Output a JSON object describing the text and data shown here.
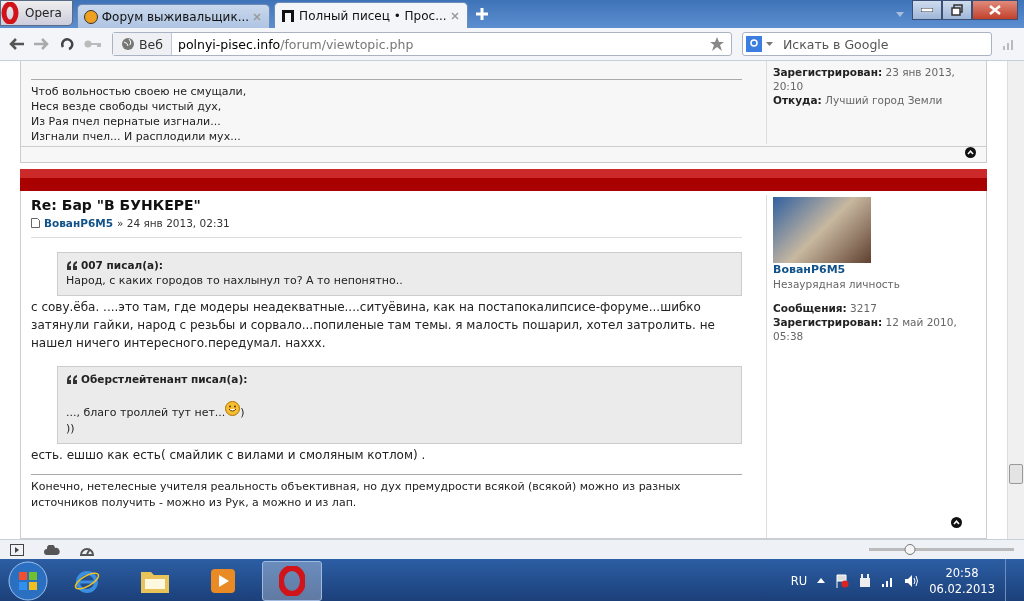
{
  "browser": {
    "menu_label": "Opera",
    "tabs": [
      {
        "title": "Форум выживальщик...",
        "kind": "forum",
        "selected": false
      },
      {
        "title": "Полный писец • Прос...",
        "kind": "letter",
        "selected": true
      }
    ],
    "toolbar": {
      "site_label": "Веб",
      "url_host": "polnyi-pisec.info",
      "url_path": "/forum/viewtopic.php",
      "search_placeholder": "Искать в Google"
    }
  },
  "previous_post": {
    "profile": [
      {
        "label": "Зарегистрирован:",
        "value": "23 янв 2013, 20:10"
      },
      {
        "label": "Откуда:",
        "value": "Лучший город Земли"
      }
    ],
    "signature": [
      "Чтоб вольностью своею не смущали,",
      "Неся везде свободы чистый дух,",
      "Из Рая пчел пернатые изгнали...",
      "Изгнали пчел... И расплодили мух..."
    ]
  },
  "post": {
    "title": "Re: Бар \"В БУНКЕРЕ\"",
    "author": "ВованР6М5",
    "date": "» 24 янв 2013, 02:31",
    "content": [
      {
        "kind": "quote",
        "author": "007 писал(а):",
        "lines": [
          {
            "text": "Народ, с каких городов то нахлынул то? А то непонятно..",
            "smiley": false
          }
        ]
      },
      {
        "kind": "text",
        "text": "с сову.ёба. ....это там, где модеры неадекватные....ситуёвина, как на постапокалипсисе-форуме...шибко затянули гайки, народ с резьбы и сорвало...попиленые там темы. я малость пошарил, хотел затролить. не нашел ничего интересного.передумал. нахxx."
      },
      {
        "kind": "quote",
        "author": "Оберстлейтенант писал(а):",
        "lines": [
          {
            "text": "..., благо троллей тут нет...",
            "smiley": true,
            "tail": ")"
          },
          {
            "text": "))",
            "smiley": false
          }
        ]
      },
      {
        "kind": "text",
        "text": "есть. ешшо как есть( смайлик с вилами и смоляным котлом) ."
      }
    ],
    "signature": "Конечно, нетелесные учителя реальность объективная, но дух премудрости всякой (всякой) можно из разных источников получить - можно из Рук, а можно и из лап.",
    "profile": {
      "name": "ВованР6М5",
      "rank": "Незаурядная личность",
      "fields": [
        {
          "label": "Сообщения:",
          "value": "3217"
        },
        {
          "label": "Зарегистрирован:",
          "value": "12 май 2010, 05:38"
        }
      ]
    }
  },
  "status_bar": {
    "zoom": {
      "level": 0.28
    }
  },
  "taskbar": {
    "apps": [
      {
        "kind": "ie",
        "selected": false
      },
      {
        "kind": "folder",
        "selected": false
      },
      {
        "kind": "media",
        "selected": false
      },
      {
        "kind": "opera",
        "selected": true
      }
    ],
    "language": "RU",
    "time": "20:58",
    "date": "06.02.2013"
  }
}
